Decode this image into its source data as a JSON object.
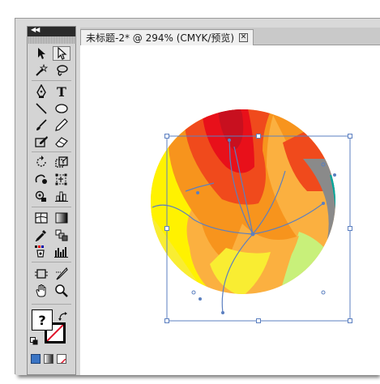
{
  "document": {
    "tab_title": "未标题-2* @ 294% (CMYK/预览)",
    "close_glyph": "✕"
  },
  "toolbox": {
    "collapse_glyph": "◀◀",
    "fill_swatch_text": "?",
    "tools": [
      {
        "name": "selection-tool-icon"
      },
      {
        "name": "direct-selection-tool-icon",
        "selected": true
      },
      {
        "name": "magic-wand-tool-icon"
      },
      {
        "name": "lasso-tool-icon"
      },
      {
        "name": "pen-tool-icon"
      },
      {
        "name": "type-tool-icon",
        "label": "T"
      },
      {
        "name": "line-segment-tool-icon"
      },
      {
        "name": "ellipse-tool-icon"
      },
      {
        "name": "paintbrush-tool-icon"
      },
      {
        "name": "pencil-tool-icon"
      },
      {
        "name": "blob-brush-tool-icon"
      },
      {
        "name": "eraser-tool-icon"
      },
      {
        "name": "rotate-tool-icon"
      },
      {
        "name": "scale-tool-icon"
      },
      {
        "name": "warp-tool-icon"
      },
      {
        "name": "free-transform-tool-icon"
      },
      {
        "name": "symbol-sprayer-tool-icon"
      },
      {
        "name": "column-graph-tool-icon"
      },
      {
        "name": "mesh-tool-icon"
      },
      {
        "name": "gradient-tool-icon"
      },
      {
        "name": "eyedropper-tool-icon"
      },
      {
        "name": "blend-tool-icon"
      },
      {
        "name": "live-paint-bucket-tool-icon"
      },
      {
        "name": "graph-tool-icon"
      },
      {
        "name": "artboard-tool-icon"
      },
      {
        "name": "slice-tool-icon"
      },
      {
        "name": "hand-tool-icon"
      },
      {
        "name": "zoom-tool-icon"
      }
    ]
  },
  "artwork": {
    "colors": {
      "red": "#e8101a",
      "dark_red": "#c8101f",
      "orange_red": "#f04a1c",
      "orange": "#f7941d",
      "light_orange": "#fbb040",
      "yellow": "#fff200",
      "light_yellow": "#f9ed32",
      "lime": "#c8f07a",
      "gray": "#8a8a8a",
      "teal": "#00a99d",
      "path_blue": "#5b7fc0"
    }
  }
}
